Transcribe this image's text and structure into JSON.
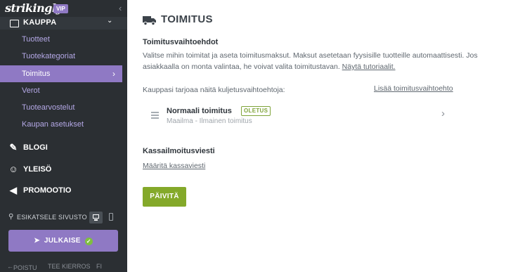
{
  "brand": {
    "logo": "strikingly",
    "badge": "VIP",
    "collapse_glyph": "‹"
  },
  "sidebar": {
    "section": {
      "label": "KAUPPA",
      "icon": "store-icon",
      "chevron": "⌄"
    },
    "subitems": [
      {
        "label": "Tuotteet",
        "active": false
      },
      {
        "label": "Tuotekategoriat",
        "active": false
      },
      {
        "label": "Toimitus",
        "active": true
      },
      {
        "label": "Verot",
        "active": false
      },
      {
        "label": "Tuotearvostelut",
        "active": false
      },
      {
        "label": "Kaupan asetukset",
        "active": false
      }
    ],
    "active_arrow": "›",
    "nav": [
      {
        "label": "BLOGI",
        "icon": "feather-icon",
        "glyph": "✎"
      },
      {
        "label": "YLEISÖ",
        "icon": "people-icon",
        "glyph": "☺"
      },
      {
        "label": "PROMOOTIO",
        "icon": "megaphone-icon",
        "glyph": "◀"
      }
    ],
    "preview": {
      "label": "ESIKATSELE SIVUSTO",
      "icon": "search-icon"
    },
    "publish": {
      "label": "JULKAISE",
      "icon": "rocket-icon"
    },
    "footer": {
      "logout": "POISTU",
      "tour": "TEE KIERROS",
      "more": "FI"
    }
  },
  "main": {
    "title": "TOIMITUS",
    "title_icon": "truck-icon",
    "shipping_options_heading": "Toimitusvaihtoehdot",
    "description": "Valitse mihin toimitat ja aseta toimitusmaksut. Maksut asetetaan fyysisille tuotteille automaattisesti. Jos asiakkaalla on monta valintaa, he voivat valita toimitustavan.",
    "tutorial_link": "Näytä tutoriaalit.",
    "offers_label": "Kauppasi tarjoaa näitä kuljetusvaihtoehtoja:",
    "add_option_link": "Lisää toimitusvaihtoehto",
    "shipping_option": {
      "name": "Normaali toimitus",
      "badge": "OLETUS",
      "subtitle": "Maailma - Ilmainen toimitus"
    },
    "checkout_heading": "Kassailmoitusviesti",
    "checkout_link": "Määritä kassaviesti",
    "update_button": "PÄIVITÄ"
  },
  "colors": {
    "sidebar_bg": "#2b2f33",
    "accent_purple": "#8f79c4",
    "update_green": "#84a92a",
    "badge_green": "#7fa43a"
  }
}
